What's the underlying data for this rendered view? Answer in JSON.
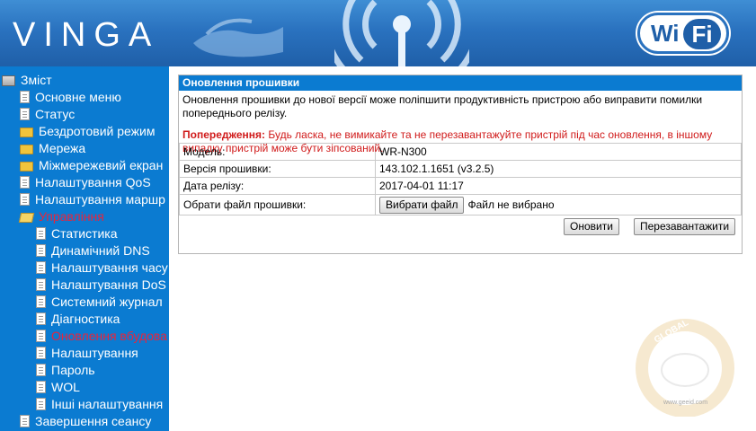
{
  "header": {
    "brand": "VINGA",
    "logo_left": "Wi",
    "logo_right": "Fi"
  },
  "sidebar": {
    "items": [
      {
        "label": "Зміст",
        "icon": "root-icon",
        "level": 0
      },
      {
        "label": "Основне меню",
        "icon": "document-icon",
        "level": 1
      },
      {
        "label": "Статус",
        "icon": "document-icon",
        "level": 1
      },
      {
        "label": "Бездротовий режим",
        "icon": "folder-icon",
        "level": 1
      },
      {
        "label": "Мережа",
        "icon": "folder-icon",
        "level": 1
      },
      {
        "label": "Міжмережевий екран",
        "icon": "folder-icon",
        "level": 1
      },
      {
        "label": "Налаштування QoS",
        "icon": "document-icon",
        "level": 1
      },
      {
        "label": "Налаштування маршр",
        "icon": "document-icon",
        "level": 1
      },
      {
        "label": "Управління",
        "icon": "folder-open-icon",
        "level": 1,
        "active": true
      },
      {
        "label": "Статистика",
        "icon": "document-icon",
        "level": 2
      },
      {
        "label": "Динамічний DNS",
        "icon": "document-icon",
        "level": 2
      },
      {
        "label": "Налаштування часу",
        "icon": "document-icon",
        "level": 2
      },
      {
        "label": "Налаштування DoS",
        "icon": "document-icon",
        "level": 2
      },
      {
        "label": "Системний журнал",
        "icon": "document-icon",
        "level": 2
      },
      {
        "label": "Діагностика",
        "icon": "document-icon",
        "level": 2
      },
      {
        "label": "Оновлення вбудова",
        "icon": "document-icon",
        "level": 2,
        "active": true
      },
      {
        "label": "Налаштування",
        "icon": "document-icon",
        "level": 2
      },
      {
        "label": "Пароль",
        "icon": "document-icon",
        "level": 2
      },
      {
        "label": "WOL",
        "icon": "document-icon",
        "level": 2
      },
      {
        "label": "Інші налаштування",
        "icon": "document-icon",
        "level": 2
      },
      {
        "label": "Завершення сеансу",
        "icon": "document-icon",
        "level": 1
      }
    ]
  },
  "main": {
    "title": "Оновлення прошивки",
    "description": "Оновлення прошивки до нової версії може поліпшити продуктивність пристрою або виправити помилки попереднього релізу.",
    "warning_label": "Попередження:",
    "warning_text": "Будь ласка, не вимикайте та не перезавантажуйте пристрій під час оновлення, в іншому випадку пристрій може бути зіпсований.",
    "rows": [
      {
        "key": "Модель:",
        "value": "WR-N300"
      },
      {
        "key": "Версія прошивки:",
        "value": "143.102.1.1651 (v3.2.5)"
      },
      {
        "key": "Дата релізу:",
        "value": "2017-04-01 11:17"
      }
    ],
    "file_label": "Обрати файл прошивки:",
    "choose_file_button": "Вибрати файл",
    "no_file_text": "Файл не вибрано",
    "update_button": "Оновити",
    "reboot_button": "Перезавантажити"
  },
  "watermark": {
    "top": "GLOBAL",
    "url": "www.geeid.com"
  },
  "colors": {
    "sidebar_bg": "#0b7bd1",
    "active_text": "#e8243c",
    "warning": "#d01a1a",
    "header_bg": "#2a72bf"
  }
}
